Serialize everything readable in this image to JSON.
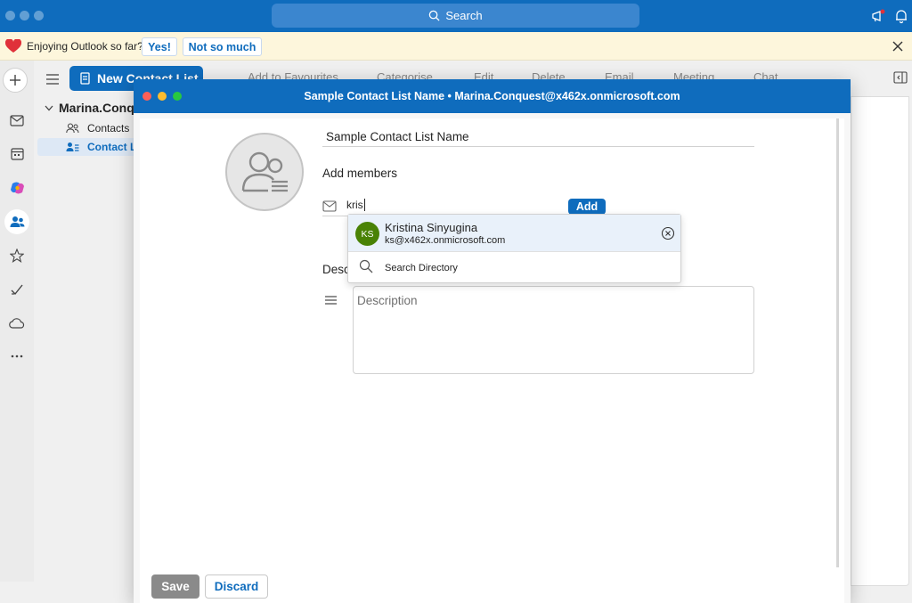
{
  "titlebar": {
    "search_label": "Search"
  },
  "banner": {
    "message": "Enjoying Outlook so far?",
    "yes_label": "Yes!",
    "no_label": "Not so much"
  },
  "toolbar": {
    "new_button": "New Contact List",
    "actions": [
      "Add to Favourites",
      "Categorise",
      "Edit",
      "Delete",
      "Email",
      "Meeting",
      "Chat",
      "..."
    ]
  },
  "folders": {
    "account": "Marina.Conquest",
    "items": [
      {
        "label": "Contacts"
      },
      {
        "label": "Contact Lists",
        "selected": true
      }
    ]
  },
  "rail": {
    "icons": [
      "mail-icon",
      "calendar-icon",
      "copilot-icon",
      "people-icon",
      "favorites-icon",
      "todo-icon",
      "cloud-icon",
      "more-icon"
    ]
  },
  "modal": {
    "title": "Sample Contact List Name • Marina.Conquest@x462x.onmicrosoft.com",
    "list_name": "Sample Contact List Name",
    "add_members_label": "Add members",
    "member_query": "kris",
    "add_button": "Add",
    "description_label": "Description",
    "description_placeholder": "Description",
    "save_button": "Save",
    "discard_button": "Discard"
  },
  "suggestion": {
    "initials": "KS",
    "name": "Kristina Sinyugina",
    "email": "ks@x462x.onmicrosoft.com",
    "search_directory": "Search Directory"
  },
  "colors": {
    "accent": "#0f6cbd",
    "avatar_green": "#498205",
    "banner_bg": "#fdf6dc"
  }
}
